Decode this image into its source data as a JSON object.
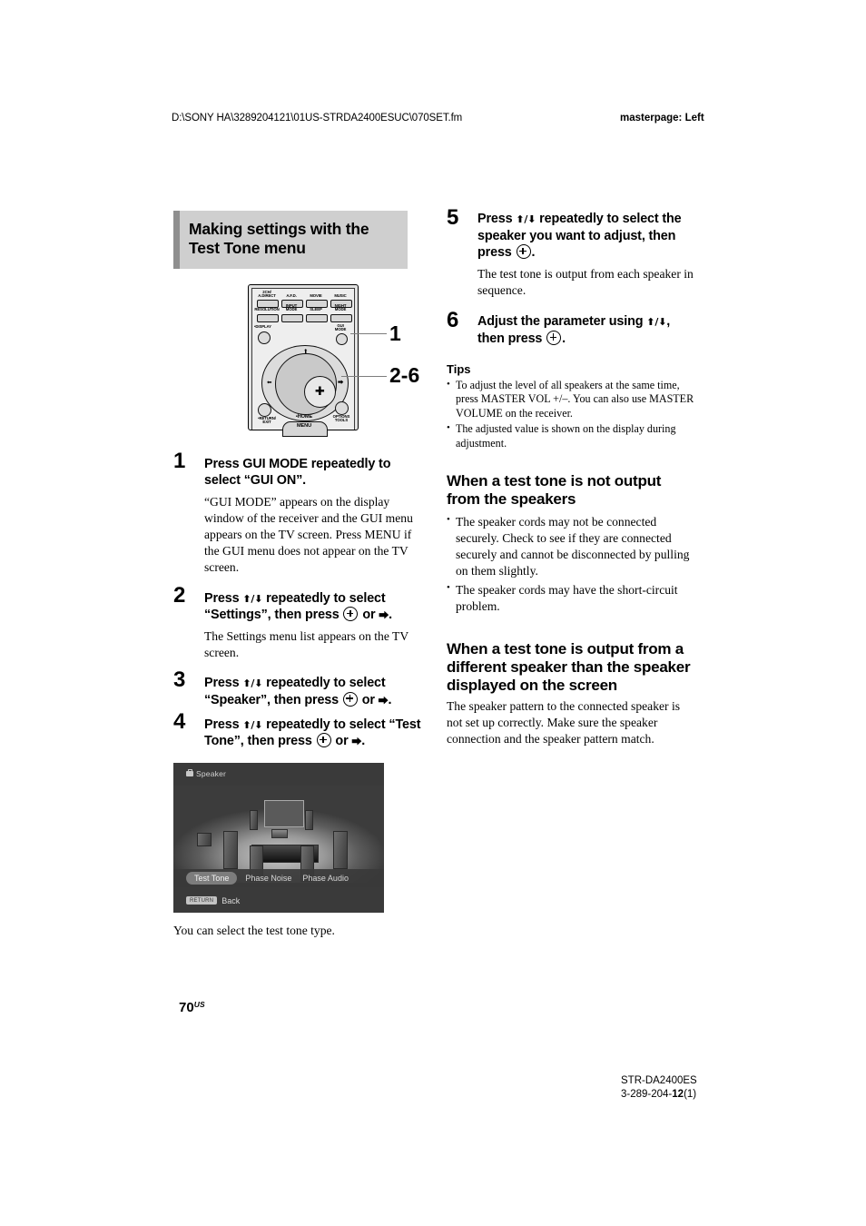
{
  "header": {
    "file_path": "D:\\SONY HA\\3289204121\\01US-STRDA2400ESUC\\070SET.fm",
    "masterpage": "masterpage: Left"
  },
  "section": {
    "banner_title": "Making settings with the Test Tone menu"
  },
  "remote": {
    "buttons_row1": [
      "2CH/\nA.DIRECT",
      "A.F.D.",
      "MOVIE",
      "MUSIC"
    ],
    "buttons_row2": [
      "RESOLUTION",
      "INPUT\nMODE",
      "SLEEP",
      "NIGHT\nMODE"
    ],
    "display_label": "•DISPLAY",
    "gui_mode_label": "GUI\nMODE",
    "return_label": "•RETURN/\nEXIT",
    "home_label": "•HOME",
    "menu_label": "MENU",
    "options_label": "OPTIONS\nTOOLS",
    "callout_1": "1",
    "callout_2_6": "2-6"
  },
  "steps": [
    {
      "num": "1",
      "head_pre": "Press GUI MODE repeatedly to select “GUI ON”.",
      "body": "“GUI MODE” appears on the display window of the receiver and the GUI menu appears on the TV screen.  Press MENU if the GUI menu does not appear on the TV screen."
    },
    {
      "num": "2",
      "head_a": "Press ",
      "head_b": " repeatedly to select “Settings”, then press ",
      "head_c": " or ",
      "head_d": ".",
      "body": "The Settings menu list appears on the TV screen."
    },
    {
      "num": "3",
      "head_a": "Press ",
      "head_b": " repeatedly to select “Speaker”, then press ",
      "head_c": " or ",
      "head_d": "."
    },
    {
      "num": "4",
      "head_a": "Press ",
      "head_b": " repeatedly to select “Test Tone”, then press ",
      "head_c": " or ",
      "head_d": "."
    },
    {
      "num": "5",
      "head_a": "Press ",
      "head_b": " repeatedly to select the speaker you want to adjust, then press ",
      "head_d": ".",
      "body": "The test tone is output from each speaker in sequence."
    },
    {
      "num": "6",
      "head_a": "Adjust the parameter using ",
      "head_b": ", then press ",
      "head_d": "."
    }
  ],
  "glyphs": {
    "up_down": "⬆/⬇",
    "right": "⮕",
    "enter": "enter-circle-plus-icon"
  },
  "tv_screen": {
    "title": "Speaker",
    "tabs": [
      "Test Tone",
      "Phase Noise",
      "Phase Audio"
    ],
    "selected_tab": "Test Tone",
    "return_key": "RETURN",
    "back_label": "Back"
  },
  "caption": "You can select the test tone type.",
  "tips": {
    "title": "Tips",
    "items": [
      "To adjust the level of all speakers at the same time, press MASTER VOL +/–. You can also use MASTER VOLUME on the receiver.",
      "The adjusted value is shown on the display during adjustment."
    ]
  },
  "section_not_output": {
    "title": "When a test tone is not output from the speakers",
    "items": [
      "The speaker cords may not be connected securely. Check to see if they are connected securely and cannot be disconnected by pulling on them slightly.",
      "The speaker cords may have the short-circuit problem."
    ]
  },
  "section_different_speaker": {
    "title": "When a test tone is output from a different speaker than the speaker displayed on the screen",
    "body": "The speaker pattern to the connected speaker is not set up correctly. Make sure the speaker connection and the speaker pattern match."
  },
  "footer": {
    "page_number": "70",
    "page_suffix": "US",
    "model": "STR-DA2400ES",
    "doc_code_pre": "3-289-204-",
    "doc_code_bold": "12",
    "doc_code_post": "(1)"
  },
  "colors": {
    "banner_bg": "#cfcfcf",
    "banner_bar": "#8f8f8f",
    "tv_bg": "#3a3a3a"
  }
}
